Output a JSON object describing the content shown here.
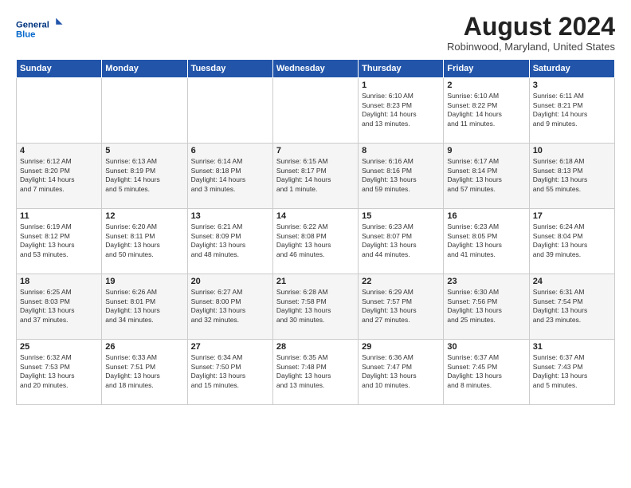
{
  "header": {
    "logo_line1": "General",
    "logo_line2": "Blue",
    "month_year": "August 2024",
    "location": "Robinwood, Maryland, United States"
  },
  "weekdays": [
    "Sunday",
    "Monday",
    "Tuesday",
    "Wednesday",
    "Thursday",
    "Friday",
    "Saturday"
  ],
  "weeks": [
    [
      {
        "day": "",
        "info": ""
      },
      {
        "day": "",
        "info": ""
      },
      {
        "day": "",
        "info": ""
      },
      {
        "day": "",
        "info": ""
      },
      {
        "day": "1",
        "info": "Sunrise: 6:10 AM\nSunset: 8:23 PM\nDaylight: 14 hours\nand 13 minutes."
      },
      {
        "day": "2",
        "info": "Sunrise: 6:10 AM\nSunset: 8:22 PM\nDaylight: 14 hours\nand 11 minutes."
      },
      {
        "day": "3",
        "info": "Sunrise: 6:11 AM\nSunset: 8:21 PM\nDaylight: 14 hours\nand 9 minutes."
      }
    ],
    [
      {
        "day": "4",
        "info": "Sunrise: 6:12 AM\nSunset: 8:20 PM\nDaylight: 14 hours\nand 7 minutes."
      },
      {
        "day": "5",
        "info": "Sunrise: 6:13 AM\nSunset: 8:19 PM\nDaylight: 14 hours\nand 5 minutes."
      },
      {
        "day": "6",
        "info": "Sunrise: 6:14 AM\nSunset: 8:18 PM\nDaylight: 14 hours\nand 3 minutes."
      },
      {
        "day": "7",
        "info": "Sunrise: 6:15 AM\nSunset: 8:17 PM\nDaylight: 14 hours\nand 1 minute."
      },
      {
        "day": "8",
        "info": "Sunrise: 6:16 AM\nSunset: 8:16 PM\nDaylight: 13 hours\nand 59 minutes."
      },
      {
        "day": "9",
        "info": "Sunrise: 6:17 AM\nSunset: 8:14 PM\nDaylight: 13 hours\nand 57 minutes."
      },
      {
        "day": "10",
        "info": "Sunrise: 6:18 AM\nSunset: 8:13 PM\nDaylight: 13 hours\nand 55 minutes."
      }
    ],
    [
      {
        "day": "11",
        "info": "Sunrise: 6:19 AM\nSunset: 8:12 PM\nDaylight: 13 hours\nand 53 minutes."
      },
      {
        "day": "12",
        "info": "Sunrise: 6:20 AM\nSunset: 8:11 PM\nDaylight: 13 hours\nand 50 minutes."
      },
      {
        "day": "13",
        "info": "Sunrise: 6:21 AM\nSunset: 8:09 PM\nDaylight: 13 hours\nand 48 minutes."
      },
      {
        "day": "14",
        "info": "Sunrise: 6:22 AM\nSunset: 8:08 PM\nDaylight: 13 hours\nand 46 minutes."
      },
      {
        "day": "15",
        "info": "Sunrise: 6:23 AM\nSunset: 8:07 PM\nDaylight: 13 hours\nand 44 minutes."
      },
      {
        "day": "16",
        "info": "Sunrise: 6:23 AM\nSunset: 8:05 PM\nDaylight: 13 hours\nand 41 minutes."
      },
      {
        "day": "17",
        "info": "Sunrise: 6:24 AM\nSunset: 8:04 PM\nDaylight: 13 hours\nand 39 minutes."
      }
    ],
    [
      {
        "day": "18",
        "info": "Sunrise: 6:25 AM\nSunset: 8:03 PM\nDaylight: 13 hours\nand 37 minutes."
      },
      {
        "day": "19",
        "info": "Sunrise: 6:26 AM\nSunset: 8:01 PM\nDaylight: 13 hours\nand 34 minutes."
      },
      {
        "day": "20",
        "info": "Sunrise: 6:27 AM\nSunset: 8:00 PM\nDaylight: 13 hours\nand 32 minutes."
      },
      {
        "day": "21",
        "info": "Sunrise: 6:28 AM\nSunset: 7:58 PM\nDaylight: 13 hours\nand 30 minutes."
      },
      {
        "day": "22",
        "info": "Sunrise: 6:29 AM\nSunset: 7:57 PM\nDaylight: 13 hours\nand 27 minutes."
      },
      {
        "day": "23",
        "info": "Sunrise: 6:30 AM\nSunset: 7:56 PM\nDaylight: 13 hours\nand 25 minutes."
      },
      {
        "day": "24",
        "info": "Sunrise: 6:31 AM\nSunset: 7:54 PM\nDaylight: 13 hours\nand 23 minutes."
      }
    ],
    [
      {
        "day": "25",
        "info": "Sunrise: 6:32 AM\nSunset: 7:53 PM\nDaylight: 13 hours\nand 20 minutes."
      },
      {
        "day": "26",
        "info": "Sunrise: 6:33 AM\nSunset: 7:51 PM\nDaylight: 13 hours\nand 18 minutes."
      },
      {
        "day": "27",
        "info": "Sunrise: 6:34 AM\nSunset: 7:50 PM\nDaylight: 13 hours\nand 15 minutes."
      },
      {
        "day": "28",
        "info": "Sunrise: 6:35 AM\nSunset: 7:48 PM\nDaylight: 13 hours\nand 13 minutes."
      },
      {
        "day": "29",
        "info": "Sunrise: 6:36 AM\nSunset: 7:47 PM\nDaylight: 13 hours\nand 10 minutes."
      },
      {
        "day": "30",
        "info": "Sunrise: 6:37 AM\nSunset: 7:45 PM\nDaylight: 13 hours\nand 8 minutes."
      },
      {
        "day": "31",
        "info": "Sunrise: 6:37 AM\nSunset: 7:43 PM\nDaylight: 13 hours\nand 5 minutes."
      }
    ]
  ]
}
